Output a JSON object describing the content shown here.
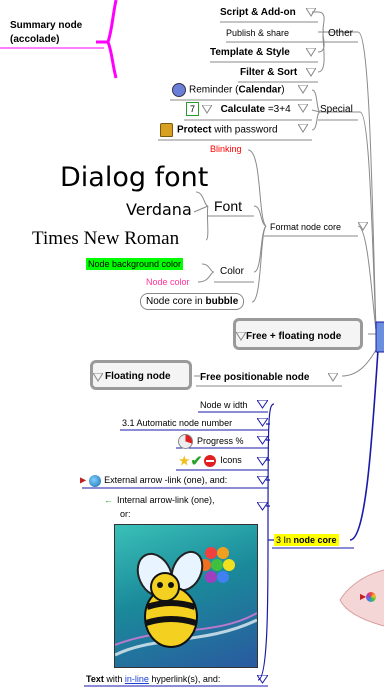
{
  "summary": {
    "line1": "Summary node",
    "line2": "(accolade)"
  },
  "other_group": {
    "items": [
      "Script & Add-on",
      "Publish & share",
      "Template & Style",
      "Filter & Sort"
    ],
    "label": "Other"
  },
  "special_group": {
    "reminder_prefix": "Reminder (",
    "reminder_bold": "Calendar",
    "reminder_suffix": ")",
    "calc_number": "7",
    "calc_label": "Calculate",
    "calc_formula": "=3+4",
    "protect_bold": "Protect",
    "protect_rest": " with password",
    "label": "Special"
  },
  "format_group": {
    "blinking": "Blinking",
    "dialog_font": "Dialog font",
    "verdana": "Verdana",
    "times": "Times New Roman",
    "font_label": "Font",
    "bg_color_label": "Node background color",
    "node_color_label": "Node color",
    "color_label": "Color",
    "bubble_prefix": "Node core in ",
    "bubble_bold": "bubble",
    "label": "Format node core"
  },
  "free_floating": {
    "label": "Free + floating node"
  },
  "floating": {
    "node_label": "Floating node",
    "label": "Free positionable node"
  },
  "node_core_group": {
    "label_prefix": "3 In ",
    "label_bold": "node core",
    "items": {
      "node_width": "Node w idth",
      "auto_number": "3.1 Automatic node number",
      "progress": "Progress %",
      "icons": "Icons",
      "external_link": "External arrow -link (one), and:",
      "internal_link_line1": "Internal arrow-link (one),",
      "internal_link_line2": "or:",
      "text_bold": "Text",
      "text_mid": " with ",
      "text_link": "in-line",
      "text_rest": " hyperlink(s), and:"
    }
  },
  "colors": {
    "summary_brace": "#ff00ff",
    "blinking": "#ff0000",
    "bg_color_highlight": "#00ff00",
    "node_color_text": "#ff3399",
    "node_core_highlight": "#ffff00",
    "connector_blue": "#1a1aa8",
    "connector_gray": "#8a8a8a"
  }
}
